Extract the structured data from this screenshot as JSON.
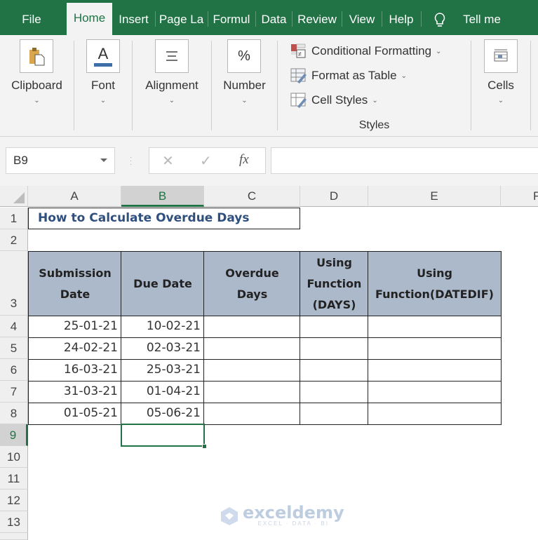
{
  "tabs": [
    {
      "label": "File",
      "active": false
    },
    {
      "label": "Home",
      "active": true
    },
    {
      "label": "Insert",
      "active": false
    },
    {
      "label": "Page La",
      "active": false
    },
    {
      "label": "Formul",
      "active": false
    },
    {
      "label": "Data",
      "active": false
    },
    {
      "label": "Review",
      "active": false
    },
    {
      "label": "View",
      "active": false
    },
    {
      "label": "Help",
      "active": false
    },
    {
      "label": "Tell me",
      "active": false
    }
  ],
  "ribbon": {
    "clipboard": "Clipboard",
    "font": "Font",
    "alignment": "Alignment",
    "number": "Number",
    "number_icon": "%",
    "conditional_formatting": "Conditional Formatting",
    "format_as_table": "Format as Table",
    "cell_styles": "Cell Styles",
    "styles": "Styles",
    "cells": "Cells",
    "font_icon": "A"
  },
  "formula_bar": {
    "name_box": "B9",
    "cancel_icon": "✕",
    "enter_icon": "✓",
    "fx_icon": "fx",
    "formula": ""
  },
  "columns": [
    "A",
    "B",
    "C",
    "D",
    "E",
    "F"
  ],
  "selected_column": "B",
  "rows": [
    "1",
    "2",
    "3",
    "4",
    "5",
    "6",
    "7",
    "8",
    "9",
    "10",
    "11",
    "12",
    "13"
  ],
  "selected_row": "9",
  "sheet": {
    "title": "How to Calculate Overdue Days",
    "headers": [
      "Submission Date",
      "Due Date",
      "Overdue Days",
      "Using Function (DAYS)",
      "Using Function(DATEDIF)"
    ],
    "data": [
      [
        "25-01-21",
        "10-02-21",
        "",
        "",
        ""
      ],
      [
        "24-02-21",
        "02-03-21",
        "",
        "",
        ""
      ],
      [
        "16-03-21",
        "25-03-21",
        "",
        "",
        ""
      ],
      [
        "31-03-21",
        "01-04-21",
        "",
        "",
        ""
      ],
      [
        "01-05-21",
        "05-06-21",
        "",
        "",
        ""
      ]
    ]
  },
  "watermark": {
    "name": "exceldemy",
    "tagline": "EXCEL · DATA · BI"
  },
  "colors": {
    "excel_green": "#217346",
    "header_fill": "#acb9ca",
    "title_color": "#2f4f7f"
  }
}
